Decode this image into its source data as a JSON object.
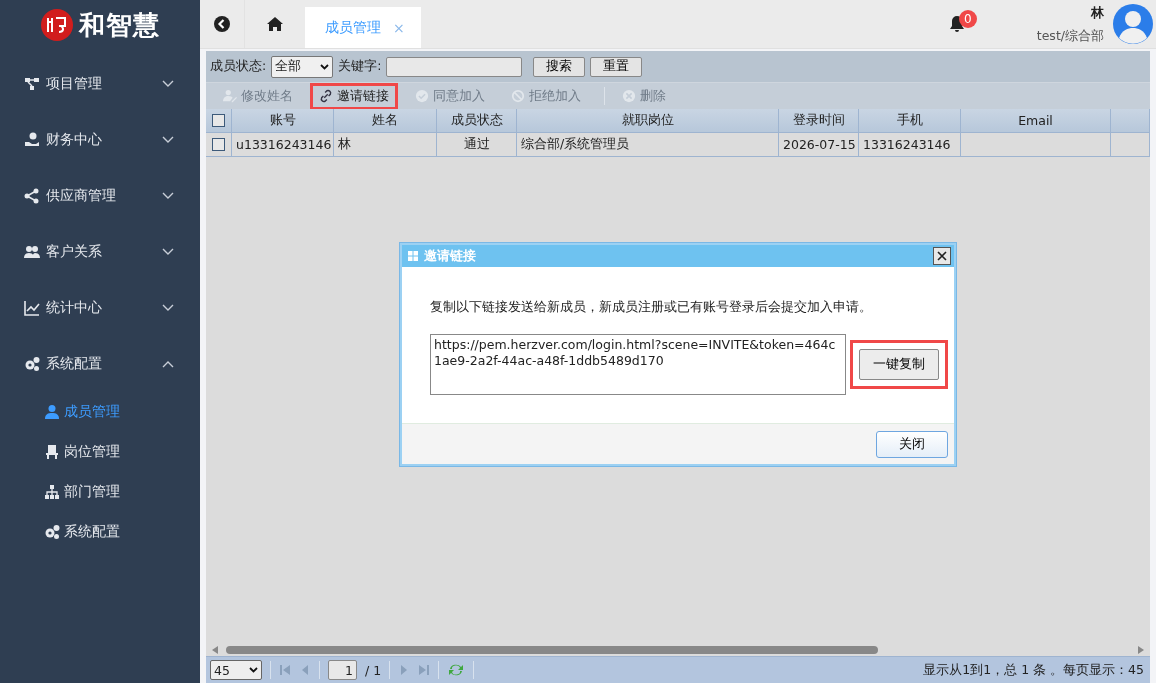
{
  "logo": {
    "text": "和智慧"
  },
  "sidebar": {
    "items": [
      {
        "label": "项目管理",
        "expanded": false
      },
      {
        "label": "财务中心",
        "expanded": false
      },
      {
        "label": "供应商管理",
        "expanded": false
      },
      {
        "label": "客户关系",
        "expanded": false
      },
      {
        "label": "统计中心",
        "expanded": false
      },
      {
        "label": "系统配置",
        "expanded": true,
        "children": [
          {
            "label": "成员管理",
            "selected": true
          },
          {
            "label": "岗位管理",
            "selected": false
          },
          {
            "label": "部门管理",
            "selected": false
          },
          {
            "label": "系统配置",
            "selected": false
          }
        ]
      }
    ]
  },
  "header": {
    "tabs": [
      {
        "label": "成员管理",
        "close": "×",
        "selected": true
      }
    ],
    "notifications": "0",
    "user": {
      "name": "林",
      "org": "test/综合部"
    }
  },
  "filter": {
    "status_label": "成员状态:",
    "status_value": "全部",
    "keyword_label": "关键字:",
    "buttons": [
      "搜索",
      "重置"
    ]
  },
  "toolbar": [
    {
      "label": "修改姓名",
      "disabled": true,
      "highlighted": false
    },
    {
      "label": "邀请链接",
      "disabled": false,
      "highlighted": true
    },
    {
      "label": "同意加入",
      "disabled": true,
      "highlighted": false
    },
    {
      "label": "拒绝加入",
      "disabled": true,
      "highlighted": false
    },
    {
      "label": "删除",
      "disabled": true,
      "highlighted": false
    }
  ],
  "table": {
    "all_checked": false,
    "columns": [
      "账号",
      "姓名",
      "成员状态",
      "就职岗位",
      "登录时间",
      "手机",
      "Email"
    ],
    "rows": [
      {
        "checked": false,
        "cells": [
          "u13316243146",
          "林",
          "通过",
          "综合部/系统管理员",
          "2026-07-15",
          "13316243146",
          ""
        ]
      }
    ]
  },
  "pagination": {
    "page_size": "45",
    "page": "1",
    "total_pages": "/ 1",
    "summary": "显示从1到1，总 1 条 。每页显示：45"
  },
  "dialog": {
    "title": "邀请链接",
    "message": "复制以下链接发送给新成员，新成员注册或已有账号登录后会提交加入申请。",
    "link": "https://pem.herzver.com/login.html?scene=INVITE&token=464c1ae9-2a2f-44ac-a48f-1ddb5489d170",
    "copy_button": {
      "label": "一键复制",
      "highlighted": true
    },
    "close_button": "关闭"
  }
}
